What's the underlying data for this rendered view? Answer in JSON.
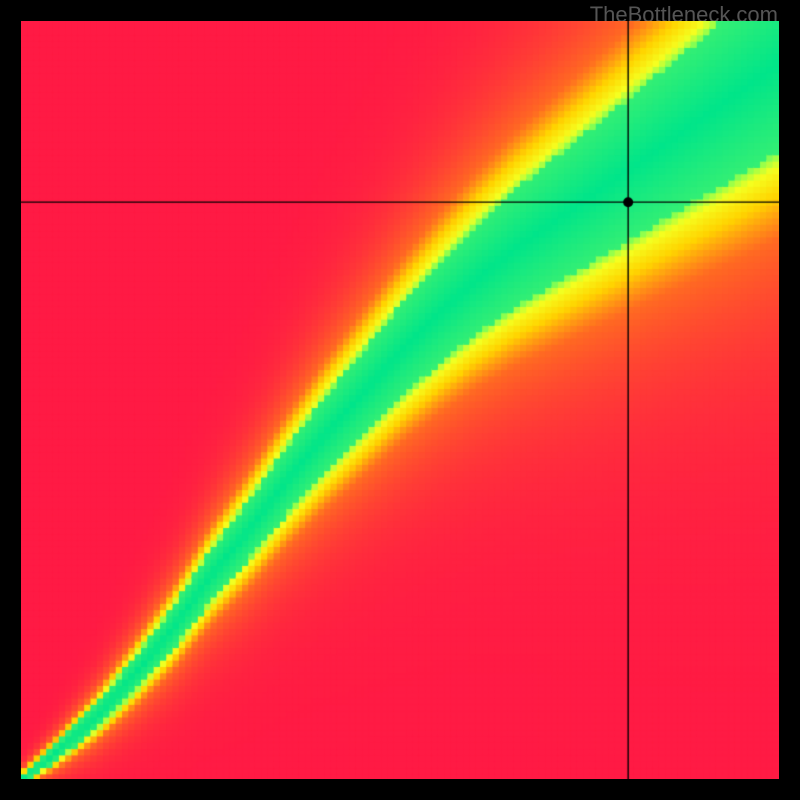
{
  "watermark": "TheBottleneck.com",
  "chart_data": {
    "type": "heatmap",
    "title": "",
    "xlabel": "",
    "ylabel": "",
    "xlim": [
      0,
      1
    ],
    "ylim": [
      0,
      1
    ],
    "crosshair": {
      "x": 0.801,
      "y": 0.761
    },
    "marker": {
      "x": 0.801,
      "y": 0.761,
      "radius": 5
    },
    "ridge": [
      {
        "x": 0.0,
        "y": 0.0
      },
      {
        "x": 0.05,
        "y": 0.04
      },
      {
        "x": 0.1,
        "y": 0.085
      },
      {
        "x": 0.15,
        "y": 0.14
      },
      {
        "x": 0.2,
        "y": 0.2
      },
      {
        "x": 0.25,
        "y": 0.27
      },
      {
        "x": 0.3,
        "y": 0.33
      },
      {
        "x": 0.35,
        "y": 0.395
      },
      {
        "x": 0.4,
        "y": 0.455
      },
      {
        "x": 0.45,
        "y": 0.51
      },
      {
        "x": 0.5,
        "y": 0.565
      },
      {
        "x": 0.55,
        "y": 0.615
      },
      {
        "x": 0.6,
        "y": 0.66
      },
      {
        "x": 0.65,
        "y": 0.7
      },
      {
        "x": 0.7,
        "y": 0.735
      },
      {
        "x": 0.75,
        "y": 0.77
      },
      {
        "x": 0.8,
        "y": 0.805
      },
      {
        "x": 0.85,
        "y": 0.84
      },
      {
        "x": 0.9,
        "y": 0.875
      },
      {
        "x": 0.95,
        "y": 0.91
      },
      {
        "x": 1.0,
        "y": 0.945
      }
    ],
    "colorscale": [
      {
        "stop": 0.0,
        "color": "#ff1a44"
      },
      {
        "stop": 0.4,
        "color": "#ff6a22"
      },
      {
        "stop": 0.6,
        "color": "#ffd400"
      },
      {
        "stop": 0.78,
        "color": "#f5ff20"
      },
      {
        "stop": 0.88,
        "color": "#8aff50"
      },
      {
        "stop": 1.0,
        "color": "#00e58a"
      }
    ]
  }
}
